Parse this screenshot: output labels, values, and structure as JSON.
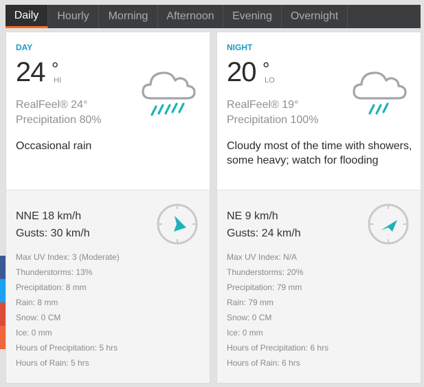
{
  "tabs": [
    {
      "label": "Daily",
      "active": true
    },
    {
      "label": "Hourly"
    },
    {
      "label": "Morning"
    },
    {
      "label": "Afternoon"
    },
    {
      "label": "Evening"
    },
    {
      "label": "Overnight"
    }
  ],
  "day": {
    "label": "DAY",
    "temp": "24",
    "deg": "°",
    "hilo": "HI",
    "realfeel": "RealFeel® 24°",
    "precipitation": "Precipitation 80%",
    "description": "Occasional rain",
    "wind": "NNE 18 km/h",
    "gusts": "Gusts: 30 km/h",
    "icon": "rain-cloud-icon",
    "stats": [
      "Max UV Index: 3 (Moderate)",
      "Thunderstorms: 13%",
      "Precipitation: 8 mm",
      "Rain: 8 mm",
      "Snow: 0 CM",
      "Ice: 0 mm",
      "Hours of Precipitation: 5 hrs",
      "Hours of Rain: 5 hrs"
    ]
  },
  "night": {
    "label": "NIGHT",
    "temp": "20",
    "deg": "°",
    "hilo": "LO",
    "realfeel": "RealFeel® 19°",
    "precipitation": "Precipitation 100%",
    "description": "Cloudy most of the time with showers, some heavy; watch for flooding",
    "wind": "NE 9 km/h",
    "gusts": "Gusts: 24 km/h",
    "icon": "rain-cloud-icon",
    "stats": [
      "Max UV Index: N/A",
      "Thunderstorms: 20%",
      "Precipitation: 79 mm",
      "Rain: 79 mm",
      "Snow: 0 CM",
      "Ice: 0 mm",
      "Hours of Precipitation: 6 hrs",
      "Hours of Rain: 6 hrs"
    ]
  },
  "colors": {
    "accent": "#f36c21",
    "label_blue": "#1b9bc0",
    "icon_teal": "#1fb3b9",
    "tabbar": "#3b3d3f"
  }
}
